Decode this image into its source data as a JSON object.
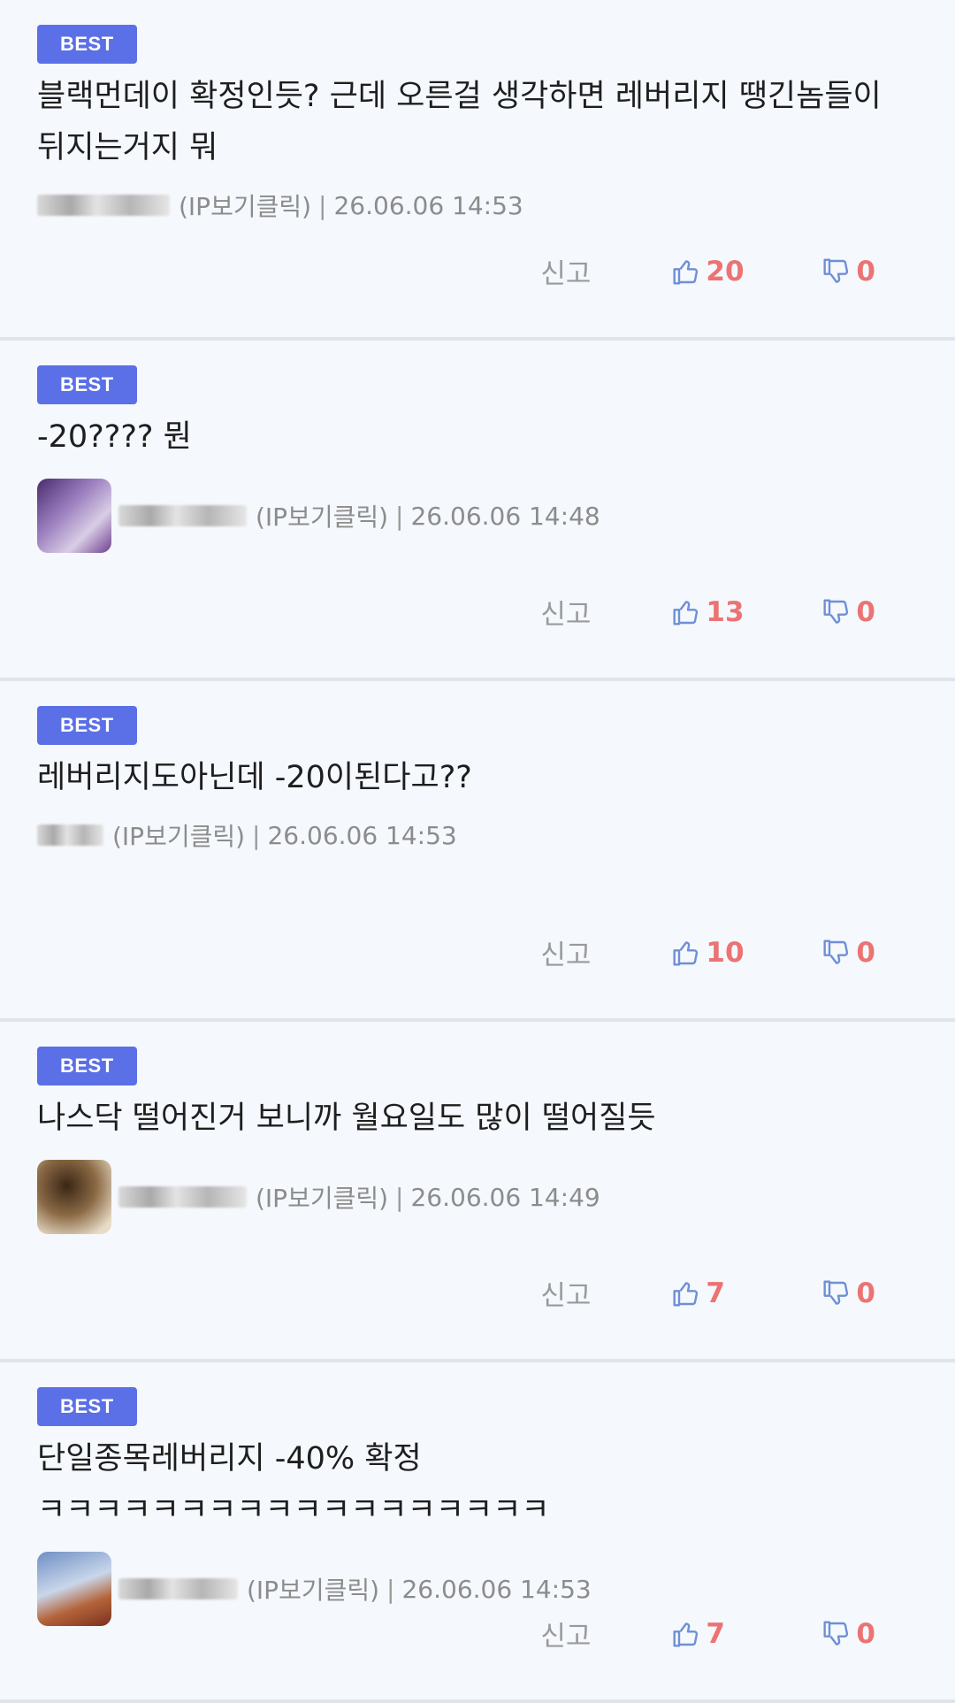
{
  "badge_label": "BEST",
  "report_label": "신고",
  "ip_label": "(IP보기클릭)",
  "separator": "|",
  "colors": {
    "badge": "#5b70e6",
    "count": "#ec7373",
    "icon": "#6f8fd6",
    "background": "#f5f8fd"
  },
  "comments": [
    {
      "text": "블랙먼데이 확정인듯? 근데 오른걸 생각하면 레버리지 땡긴놈들이 뒤지는거지 뭐",
      "timestamp": "26.06.06 14:53",
      "likes": "20",
      "dislikes": "0"
    },
    {
      "text": "-20????  뭔",
      "timestamp": "26.06.06 14:48",
      "likes": "13",
      "dislikes": "0"
    },
    {
      "text": "레버리지도아닌데 -20이된다고??",
      "timestamp": "26.06.06 14:53",
      "likes": "10",
      "dislikes": "0"
    },
    {
      "text": "나스닥 떨어진거 보니까 월요일도 많이 떨어질듯",
      "timestamp": "26.06.06 14:49",
      "likes": "7",
      "dislikes": "0"
    },
    {
      "text": "단일종목레버리지 -40% 확정 ㅋㅋㅋㅋㅋㅋㅋㅋㅋㅋㅋㅋㅋㅋㅋㅋㅋㅋ",
      "timestamp": "26.06.06 14:53",
      "likes": "7",
      "dislikes": "0"
    }
  ]
}
